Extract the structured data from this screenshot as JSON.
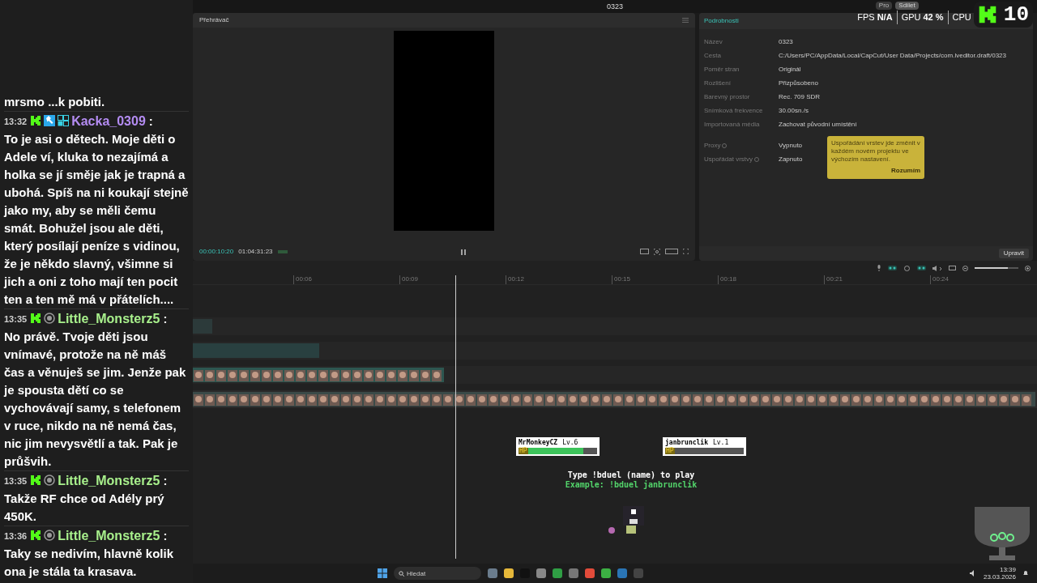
{
  "chat": {
    "cut_line": "mrsmo ...k pobiti.",
    "messages": [
      {
        "time": "13:32",
        "badges": [
          {
            "kind": "kick"
          },
          {
            "kind": "moderator"
          },
          {
            "kind": "og"
          }
        ],
        "user": "Kacka_0309",
        "color": "#b48cf2",
        "separator": ":",
        "text": "To je asi o dětech. Moje děti o Adele ví, kluka to nezajímá a holka se jí směje jak je trapná a ubohá. Spíš na ni koukají stejně jako my, aby se měli čemu smát. Bohužel jsou ale děti, který posílají peníze s vidinou, že je někdo slavný, všimne si jich a oni z toho mají ten pocit ten a ten mě má v přátelích...."
      },
      {
        "time": "13:35",
        "badges": [
          {
            "kind": "kick"
          },
          {
            "kind": "subscriber"
          }
        ],
        "user": "Little_Monsterz5",
        "color": "#a8f08c",
        "separator": ":",
        "text": "No právě. Tvoje děti jsou vnímavé, protože na ně máš čas a věnuješ se jim. Jenže pak je spousta dětí co se vychovávají samy, s telefonem v ruce, nikdo na ně nemá čas, nic jim nevysvětlí a tak. Pak je průšvih."
      },
      {
        "time": "13:35",
        "badges": [
          {
            "kind": "kick"
          },
          {
            "kind": "subscriber"
          }
        ],
        "user": "Little_Monsterz5",
        "color": "#a8f08c",
        "separator": ":",
        "text": "Takže RF chce od Adély prý 450K."
      },
      {
        "time": "13:36",
        "badges": [
          {
            "kind": "kick"
          },
          {
            "kind": "subscriber"
          }
        ],
        "user": "Little_Monsterz5",
        "color": "#a8f08c",
        "separator": ":",
        "text": "Taky se nedivím, hlavně kolik ona je stála ta krasava."
      }
    ]
  },
  "window": {
    "title": "0323",
    "buttons": [
      "Pro",
      "Sdílet"
    ]
  },
  "stats": [
    {
      "label": "FPS",
      "value": "N/A"
    },
    {
      "label": "GPU",
      "value": "42 %"
    },
    {
      "label": "CPU"
    }
  ],
  "kick_badge": {
    "count": "10"
  },
  "player": {
    "title": "Přehrávač",
    "current_time": "00:00:10:20",
    "duration": "01:04:31:23"
  },
  "details": {
    "title": "Podrobnosti",
    "rows": [
      {
        "label": "Název",
        "value": "0323"
      },
      {
        "label": "Cesta",
        "value": "C:/Users/PC/AppData/Local/CapCut/User Data/Projects/com.lveditor.draft/0323"
      },
      {
        "label": "Poměr stran",
        "value": "Originál"
      },
      {
        "label": "Rozlišení",
        "value": "Přizpůsobeno"
      },
      {
        "label": "Barevný prostor",
        "value": "Rec. 709 SDR"
      },
      {
        "label": "Snímková frekvence",
        "value": "30.00sn./s"
      },
      {
        "label": "Importovaná média",
        "value": "Zachovat původní umístění"
      }
    ],
    "settings": [
      {
        "label": "Proxy",
        "value": "Vypnuto"
      },
      {
        "label": "Uspořádat vrstvy",
        "value": "Zapnuto"
      }
    ],
    "tooltip": {
      "text": "Uspořádání vrstev jde změnit v každém novém projektu ve výchozím nastavení.",
      "button": "Rozumím"
    },
    "edit_button": "Upravit"
  },
  "timeline": {
    "ticks": [
      "00:06",
      "00:09",
      "00:12",
      "00:15",
      "00:18",
      "00:21",
      "00:24"
    ],
    "zoom": {
      "level": 0.75
    }
  },
  "game": {
    "players": [
      {
        "name": "MrMonkeyCZ",
        "level_label": "Lv.6",
        "hp_label": "HP",
        "level": 0.8
      },
      {
        "name": "janbrunclik",
        "level_label": "Lv.1",
        "hp_label": "HP",
        "level": 0
      }
    ],
    "instruction": "Type !bduel (name) to play",
    "example": "Example: !bduel janbrunclik"
  },
  "taskbar": {
    "search_placeholder": "Hledat",
    "time": "13:39",
    "date": "23.03.2026"
  }
}
